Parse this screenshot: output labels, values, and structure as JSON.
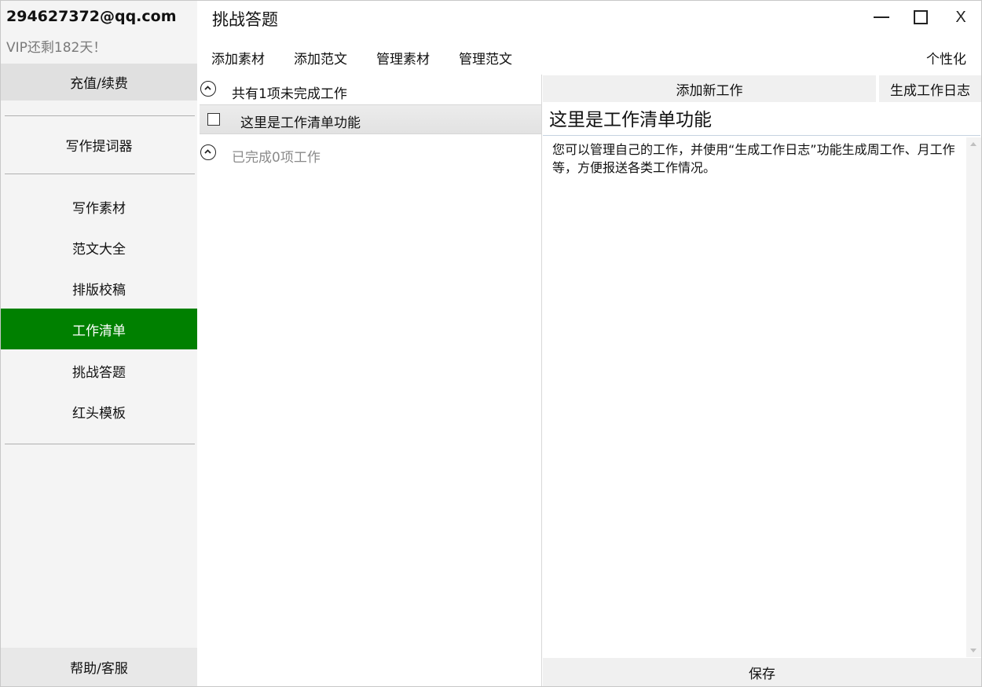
{
  "sidebar": {
    "user_email": "294627372@qq.com",
    "vip_status": "VIP还剩182天！",
    "recharge_label": "充值/续费",
    "items": [
      {
        "label": "写作提词器"
      },
      {
        "label": "写作素材"
      },
      {
        "label": "范文大全"
      },
      {
        "label": "排版校稿"
      },
      {
        "label": "工作清单",
        "active": true
      },
      {
        "label": "挑战答题"
      },
      {
        "label": "红头模板"
      }
    ],
    "help_label": "帮助/客服"
  },
  "titlebar": {
    "title": "挑战答题",
    "close_label": "X"
  },
  "toolbar": {
    "items": [
      {
        "label": "添加素材"
      },
      {
        "label": "添加范文"
      },
      {
        "label": "管理素材"
      },
      {
        "label": "管理范文"
      }
    ],
    "personalize_label": "个性化"
  },
  "task_list": {
    "pending_header": "共有1项未完成工作",
    "tasks": [
      {
        "title": "这里是工作清单功能",
        "checked": false
      }
    ],
    "completed_header": "已完成0项工作"
  },
  "detail": {
    "add_task_label": "添加新工作",
    "generate_log_label": "生成工作日志",
    "title": "这里是工作清单功能",
    "body": "您可以管理自己的工作，并使用“生成工作日志”功能生成周工作、月工作等，方便报送各类工作情况。",
    "save_label": "保存"
  },
  "colors": {
    "active_nav": "#008000",
    "sidebar_bg": "#f4f4f4"
  }
}
